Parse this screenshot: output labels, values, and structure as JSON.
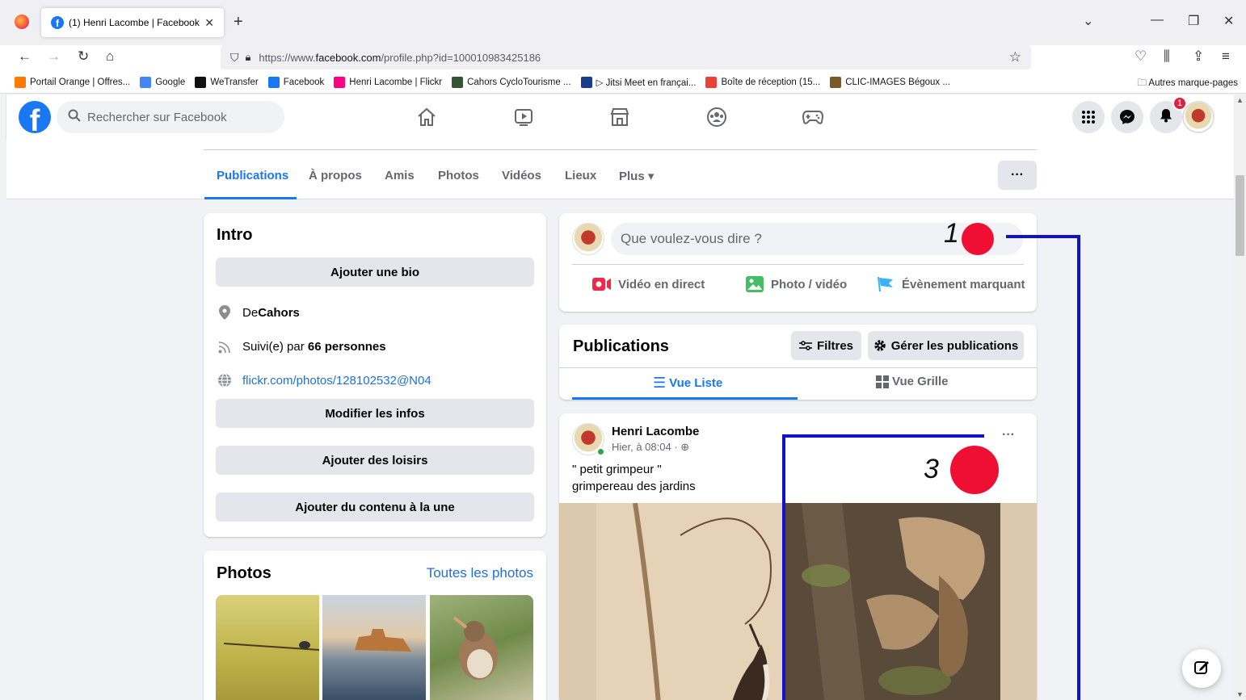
{
  "browser": {
    "tab_title": "(1) Henri Lacombe | Facebook",
    "url_prefix": "https://www.",
    "url_domain": "facebook.com",
    "url_path": "/profile.php?id=100010983425186",
    "bookmarks": [
      {
        "label": "Portail Orange | Offres...",
        "color": "#ff7900"
      },
      {
        "label": "Google",
        "color": "#4285f4"
      },
      {
        "label": "WeTransfer",
        "color": "#111111"
      },
      {
        "label": "Facebook",
        "color": "#1877f2"
      },
      {
        "label": "Henri Lacombe | Flickr",
        "color": "#ff0084"
      },
      {
        "label": "Cahors CycloTourisme ...",
        "color": "#335533"
      },
      {
        "label": "▷ Jitsi Meet en françai...",
        "color": "#1b3c8c"
      },
      {
        "label": "Boîte de réception (15...",
        "color": "#ea4335"
      },
      {
        "label": "CLIC-IMAGES Bégoux ...",
        "color": "#7a5a2a"
      }
    ],
    "other_bookmarks": "Autres marque-pages"
  },
  "fb_header": {
    "search_placeholder": "Rechercher sur Facebook",
    "notifications_count": "1"
  },
  "profile_tabs": [
    "Publications",
    "À propos",
    "Amis",
    "Photos",
    "Vidéos",
    "Lieux",
    "Plus ▾"
  ],
  "intro": {
    "title": "Intro",
    "add_bio": "Ajouter une bio",
    "from_prefix": "De ",
    "from_city": "Cahors",
    "followed_prefix": "Suivi(e) par ",
    "followers": "66 personnes",
    "website": "flickr.com/photos/128102532@N04",
    "edit_info": "Modifier les infos",
    "add_hobbies": "Ajouter des loisirs",
    "add_featured": "Ajouter du contenu à la une"
  },
  "photos": {
    "title": "Photos",
    "see_all": "Toutes les photos"
  },
  "composer": {
    "placeholder": "Que voulez-vous dire ?",
    "live": "Vidéo en direct",
    "photo": "Photo / vidéo",
    "event": "Évènement marquant"
  },
  "publications": {
    "title": "Publications",
    "filters": "Filtres",
    "manage": "Gérer les publications",
    "list_view": "Vue Liste",
    "grid_view": "Vue Grille"
  },
  "post": {
    "author": "Henri Lacombe",
    "time": "Hier, à 08:04 · ",
    "line1": "\" petit grimpeur \"",
    "line2": "grimpereau des jardins"
  },
  "annotations": {
    "one": "1",
    "three": "3",
    "dot_color": "#ef0f32",
    "line_color": "#1010d0"
  }
}
